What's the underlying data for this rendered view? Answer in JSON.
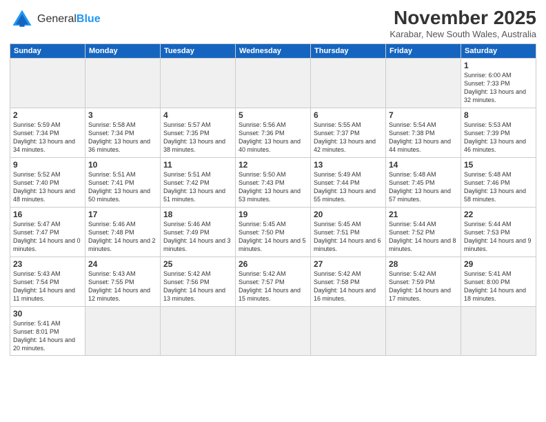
{
  "header": {
    "logo_general": "General",
    "logo_blue": "Blue",
    "month_title": "November 2025",
    "location": "Karabar, New South Wales, Australia"
  },
  "weekdays": [
    "Sunday",
    "Monday",
    "Tuesday",
    "Wednesday",
    "Thursday",
    "Friday",
    "Saturday"
  ],
  "days": {
    "1": {
      "sunrise": "6:00 AM",
      "sunset": "7:33 PM",
      "daylight": "13 hours and 32 minutes."
    },
    "2": {
      "sunrise": "5:59 AM",
      "sunset": "7:34 PM",
      "daylight": "13 hours and 34 minutes."
    },
    "3": {
      "sunrise": "5:58 AM",
      "sunset": "7:34 PM",
      "daylight": "13 hours and 36 minutes."
    },
    "4": {
      "sunrise": "5:57 AM",
      "sunset": "7:35 PM",
      "daylight": "13 hours and 38 minutes."
    },
    "5": {
      "sunrise": "5:56 AM",
      "sunset": "7:36 PM",
      "daylight": "13 hours and 40 minutes."
    },
    "6": {
      "sunrise": "5:55 AM",
      "sunset": "7:37 PM",
      "daylight": "13 hours and 42 minutes."
    },
    "7": {
      "sunrise": "5:54 AM",
      "sunset": "7:38 PM",
      "daylight": "13 hours and 44 minutes."
    },
    "8": {
      "sunrise": "5:53 AM",
      "sunset": "7:39 PM",
      "daylight": "13 hours and 46 minutes."
    },
    "9": {
      "sunrise": "5:52 AM",
      "sunset": "7:40 PM",
      "daylight": "13 hours and 48 minutes."
    },
    "10": {
      "sunrise": "5:51 AM",
      "sunset": "7:41 PM",
      "daylight": "13 hours and 50 minutes."
    },
    "11": {
      "sunrise": "5:51 AM",
      "sunset": "7:42 PM",
      "daylight": "13 hours and 51 minutes."
    },
    "12": {
      "sunrise": "5:50 AM",
      "sunset": "7:43 PM",
      "daylight": "13 hours and 53 minutes."
    },
    "13": {
      "sunrise": "5:49 AM",
      "sunset": "7:44 PM",
      "daylight": "13 hours and 55 minutes."
    },
    "14": {
      "sunrise": "5:48 AM",
      "sunset": "7:45 PM",
      "daylight": "13 hours and 57 minutes."
    },
    "15": {
      "sunrise": "5:48 AM",
      "sunset": "7:46 PM",
      "daylight": "13 hours and 58 minutes."
    },
    "16": {
      "sunrise": "5:47 AM",
      "sunset": "7:47 PM",
      "daylight": "14 hours and 0 minutes."
    },
    "17": {
      "sunrise": "5:46 AM",
      "sunset": "7:48 PM",
      "daylight": "14 hours and 2 minutes."
    },
    "18": {
      "sunrise": "5:46 AM",
      "sunset": "7:49 PM",
      "daylight": "14 hours and 3 minutes."
    },
    "19": {
      "sunrise": "5:45 AM",
      "sunset": "7:50 PM",
      "daylight": "14 hours and 5 minutes."
    },
    "20": {
      "sunrise": "5:45 AM",
      "sunset": "7:51 PM",
      "daylight": "14 hours and 6 minutes."
    },
    "21": {
      "sunrise": "5:44 AM",
      "sunset": "7:52 PM",
      "daylight": "14 hours and 8 minutes."
    },
    "22": {
      "sunrise": "5:44 AM",
      "sunset": "7:53 PM",
      "daylight": "14 hours and 9 minutes."
    },
    "23": {
      "sunrise": "5:43 AM",
      "sunset": "7:54 PM",
      "daylight": "14 hours and 11 minutes."
    },
    "24": {
      "sunrise": "5:43 AM",
      "sunset": "7:55 PM",
      "daylight": "14 hours and 12 minutes."
    },
    "25": {
      "sunrise": "5:42 AM",
      "sunset": "7:56 PM",
      "daylight": "14 hours and 13 minutes."
    },
    "26": {
      "sunrise": "5:42 AM",
      "sunset": "7:57 PM",
      "daylight": "14 hours and 15 minutes."
    },
    "27": {
      "sunrise": "5:42 AM",
      "sunset": "7:58 PM",
      "daylight": "14 hours and 16 minutes."
    },
    "28": {
      "sunrise": "5:42 AM",
      "sunset": "7:59 PM",
      "daylight": "14 hours and 17 minutes."
    },
    "29": {
      "sunrise": "5:41 AM",
      "sunset": "8:00 PM",
      "daylight": "14 hours and 18 minutes."
    },
    "30": {
      "sunrise": "5:41 AM",
      "sunset": "8:01 PM",
      "daylight": "14 hours and 20 minutes."
    }
  }
}
